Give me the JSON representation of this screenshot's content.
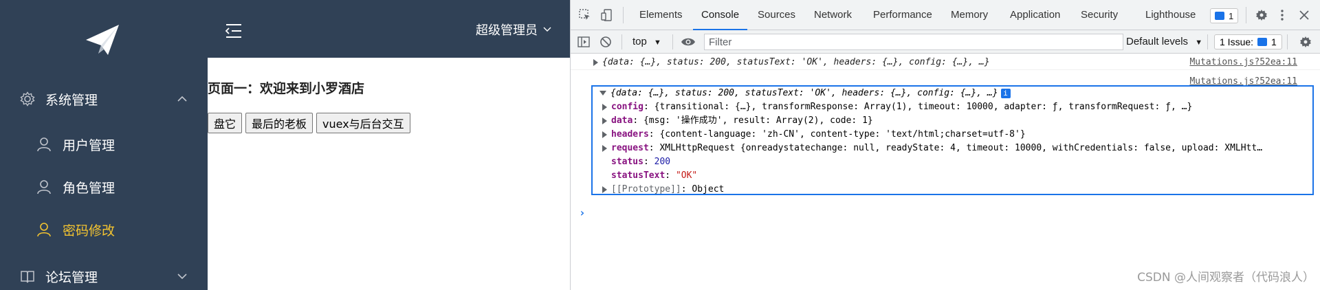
{
  "sidebar": {
    "logo": "paper-plane-logo",
    "menus": [
      {
        "label": "系统管理",
        "icon": "gear-icon",
        "expanded": true
      },
      {
        "label": "论坛管理",
        "icon": "book-icon",
        "expanded": false
      }
    ],
    "submenu": [
      {
        "label": "用户管理",
        "icon": "user-icon",
        "active": false
      },
      {
        "label": "角色管理",
        "icon": "user-icon",
        "active": false
      },
      {
        "label": "密码修改",
        "icon": "user-icon",
        "active": true
      }
    ],
    "colors": {
      "bg": "#304156",
      "active": "#f4c430"
    }
  },
  "header": {
    "user_label": "超级管理员"
  },
  "content": {
    "heading": "页面一：欢迎来到小罗酒店",
    "buttons": [
      "盘它",
      "最后的老板",
      "vuex与后台交互"
    ]
  },
  "devtools": {
    "tabs": [
      "Elements",
      "Console",
      "Sources",
      "Network",
      "Performance",
      "Memory",
      "Application",
      "Security",
      "Lighthouse"
    ],
    "active_tab": "Console",
    "badge_count": "1",
    "toolbar": {
      "context": "top",
      "filter_placeholder": "Filter",
      "levels": "Default levels",
      "issues": "1 Issue:",
      "issues_count": "1"
    },
    "logs": [
      {
        "preview": "{data: {…}, status: 200, statusText: 'OK', headers: {…}, config: {…}, …}",
        "source": "Mutations.js?52ea:11"
      },
      {
        "preview": "{data: {…}, status: 200, statusText: 'OK', headers: {…}, config: {…}, …}",
        "source": "Mutations.js?52ea:11"
      }
    ],
    "expanded_props": {
      "config": "{transitional: {…}, transformResponse: Array(1), timeout: 10000, adapter: ƒ, transformRequest: ƒ, …}",
      "data": "{msg: '操作成功', result: Array(2), code: 1}",
      "headers": "{content-language: 'zh-CN', content-type: 'text/html;charset=utf-8'}",
      "request": "XMLHttpRequest {onreadystatechange: null, readyState: 4, timeout: 10000, withCredentials: false, upload: XMLHtt…",
      "status": "200",
      "statusText": "\"OK\"",
      "prototype": "Object"
    }
  },
  "watermark": "CSDN @人间观察者（代码浪人）"
}
